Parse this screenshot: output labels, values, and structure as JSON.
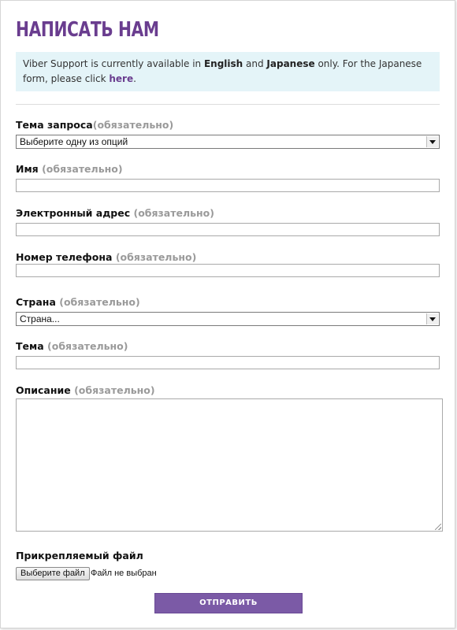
{
  "page": {
    "title": "НАПИСАТЬ НАМ"
  },
  "notice": {
    "text_1": "Viber Support is currently available in ",
    "lang_1": "English",
    "text_2": " and ",
    "lang_2": "Japanese",
    "text_3": " only. For the Japanese form, please click ",
    "link": "here",
    "text_4": "."
  },
  "form": {
    "topic": {
      "label": "Тема запроса",
      "required": "(обязательно)",
      "value": "Выберите одну из опций"
    },
    "name": {
      "label": "Имя ",
      "required": "(обязательно)",
      "value": ""
    },
    "email": {
      "label": "Электронный адрес ",
      "required": "(обязательно)",
      "value": ""
    },
    "phone": {
      "label": "Номер телефона ",
      "required": "(обязательно)",
      "value": ""
    },
    "country": {
      "label": "Страна ",
      "required": "(обязательно)",
      "value": "Страна..."
    },
    "subject": {
      "label": "Тема ",
      "required": "(обязательно)",
      "value": ""
    },
    "description": {
      "label": "Описание ",
      "required": "(обязательно)",
      "value": ""
    },
    "attachment": {
      "label": "Прикрепляемый файл",
      "button": "Выберите файл",
      "status": "Файл не выбран"
    },
    "submit": "ОТПРАВИТЬ"
  },
  "colors": {
    "brand": "#6a3d8f",
    "button": "#7b5aa6",
    "notice_bg": "#e4f4f8",
    "required_text": "#9a9a9a"
  }
}
